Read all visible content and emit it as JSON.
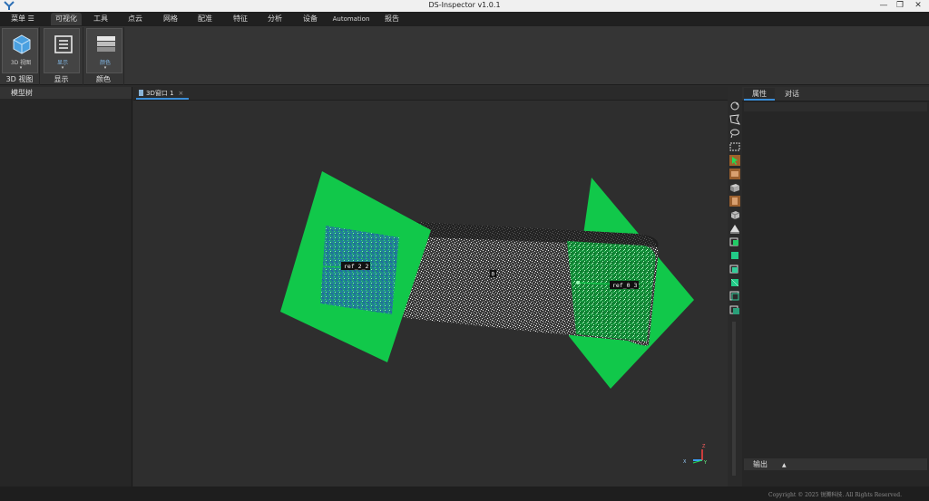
{
  "window": {
    "title": "DS-Inspector v1.0.1",
    "minimize": "—",
    "restore": "❐",
    "close": "✕"
  },
  "menubar": {
    "menu_label": "菜单 ☰",
    "tabs": [
      "可视化",
      "工具",
      "点云",
      "网格",
      "配准",
      "特征",
      "分析",
      "设备",
      "Automation",
      "报告"
    ],
    "active_tab": "可视化"
  },
  "ribbon": {
    "groups": [
      {
        "button_label": "3D 视图",
        "group_label": "3D 视图"
      },
      {
        "button_label": "显示",
        "group_label": "显示"
      },
      {
        "button_label": "颜色",
        "group_label": "颜色"
      }
    ],
    "caret": "▾"
  },
  "left_panel": {
    "title": "模型树"
  },
  "viewport": {
    "tab_label": "3D窗口 1",
    "tab_close": "×",
    "labels": {
      "ref_left": "ref_2_2",
      "ref_right": "ref_0_3",
      "center": "0"
    },
    "axes": {
      "x": "X",
      "y": "Y",
      "z": "Z"
    },
    "colors": {
      "plane": "#11c84a",
      "cloud": "#c8c8c8",
      "background": "#2e2e2e"
    }
  },
  "right_panel": {
    "tabs": [
      "属性",
      "对话"
    ],
    "active_tab": "属性",
    "output_label": "输出",
    "output_toggle": "▲"
  },
  "status": {
    "copyright": "Copyright © 2025 锐腾科技. All Rights Reserved."
  }
}
